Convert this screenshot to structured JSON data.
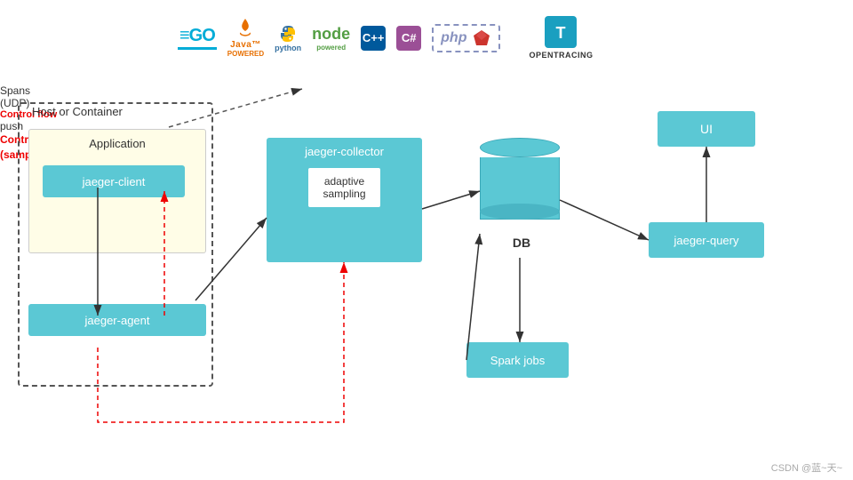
{
  "logos": {
    "go": "≡GO",
    "java": "Java™",
    "python": "python",
    "node": "node",
    "cpp": "C++",
    "csharp": "C#",
    "php": "php",
    "ruby": "◆",
    "opentracing": "OPENTRACING"
  },
  "diagram": {
    "host_container_label": "Host or Container",
    "application_label": "Application",
    "jaeger_client_label": "jaeger-client",
    "jaeger_agent_label": "jaeger-agent",
    "jaeger_collector_label": "jaeger-collector",
    "adaptive_sampling_label": "adaptive\nsampling",
    "db_label": "DB",
    "spark_jobs_label": "Spark jobs",
    "jaeger_query_label": "jaeger-query",
    "ui_label": "UI",
    "spans_label": "Spans\n(UDP)",
    "control_flow_label": "Control flow",
    "push_label": "push",
    "control_flow_bottom_label": "Control flow poll\n(sampling, etc.)"
  },
  "footer": {
    "text": "CSDN @蓝~天~"
  },
  "colors": {
    "cyan": "#5BC8D4",
    "red": "#E00000",
    "dark": "#333333",
    "dashed_border": "#555555"
  }
}
